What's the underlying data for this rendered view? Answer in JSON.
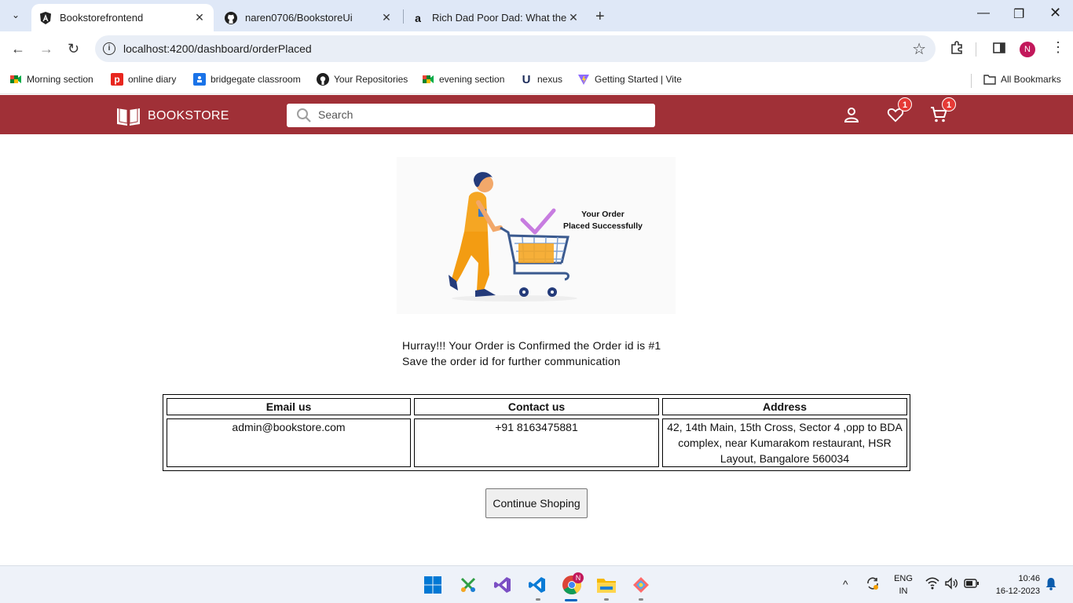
{
  "browser": {
    "tabs": [
      {
        "title": "Bookstorefrontend",
        "icon": "angular-icon",
        "active": true
      },
      {
        "title": "naren0706/BookstoreUi",
        "icon": "github-icon",
        "active": false
      },
      {
        "title": "Rich Dad Poor Dad: What the Ri",
        "icon": "amazon-icon",
        "active": false
      }
    ],
    "url": "localhost:4200/dashboard/orderPlaced",
    "profile_initial": "N",
    "bookmarks": [
      {
        "label": "Morning section",
        "icon": "meet-icon"
      },
      {
        "label": "online diary",
        "icon": "diary-icon"
      },
      {
        "label": "bridgegate classroom",
        "icon": "classroom-icon"
      },
      {
        "label": "Your Repositories",
        "icon": "github-icon"
      },
      {
        "label": "evening section",
        "icon": "meet-icon"
      },
      {
        "label": "nexus",
        "icon": "nexus-icon"
      },
      {
        "label": "Getting Started | Vite",
        "icon": "vite-icon"
      }
    ],
    "all_bookmarks_label": "All Bookmarks"
  },
  "header": {
    "brand": "BOOKSTORE",
    "search_placeholder": "Search",
    "wishlist_count": "1",
    "cart_count": "1"
  },
  "order": {
    "illustration_title_line1": "Your Order",
    "illustration_title_line2": "Placed Successfully",
    "message_line1": "Hurray!!! Your Order is Confirmed the Order id is #1",
    "message_line2": "Save the order id for further communication"
  },
  "contact_table": {
    "headers": [
      "Email us",
      "Contact us",
      "Address"
    ],
    "values": [
      "admin@bookstore.com",
      "+91 8163475881",
      "42, 14th Main, 15th Cross, Sector 4 ,opp to BDA complex, near Kumarakom restaurant, HSR Layout, Bangalore 560034"
    ]
  },
  "continue_button_label": "Continue Shoping",
  "taskbar": {
    "language_line1": "ENG",
    "language_line2": "IN",
    "time": "10:46",
    "date": "16-12-2023",
    "chrome_badge": "N"
  },
  "colors": {
    "header_bg": "#a03037",
    "badge": "#e53935",
    "tabstrip": "#dfe8f7"
  }
}
